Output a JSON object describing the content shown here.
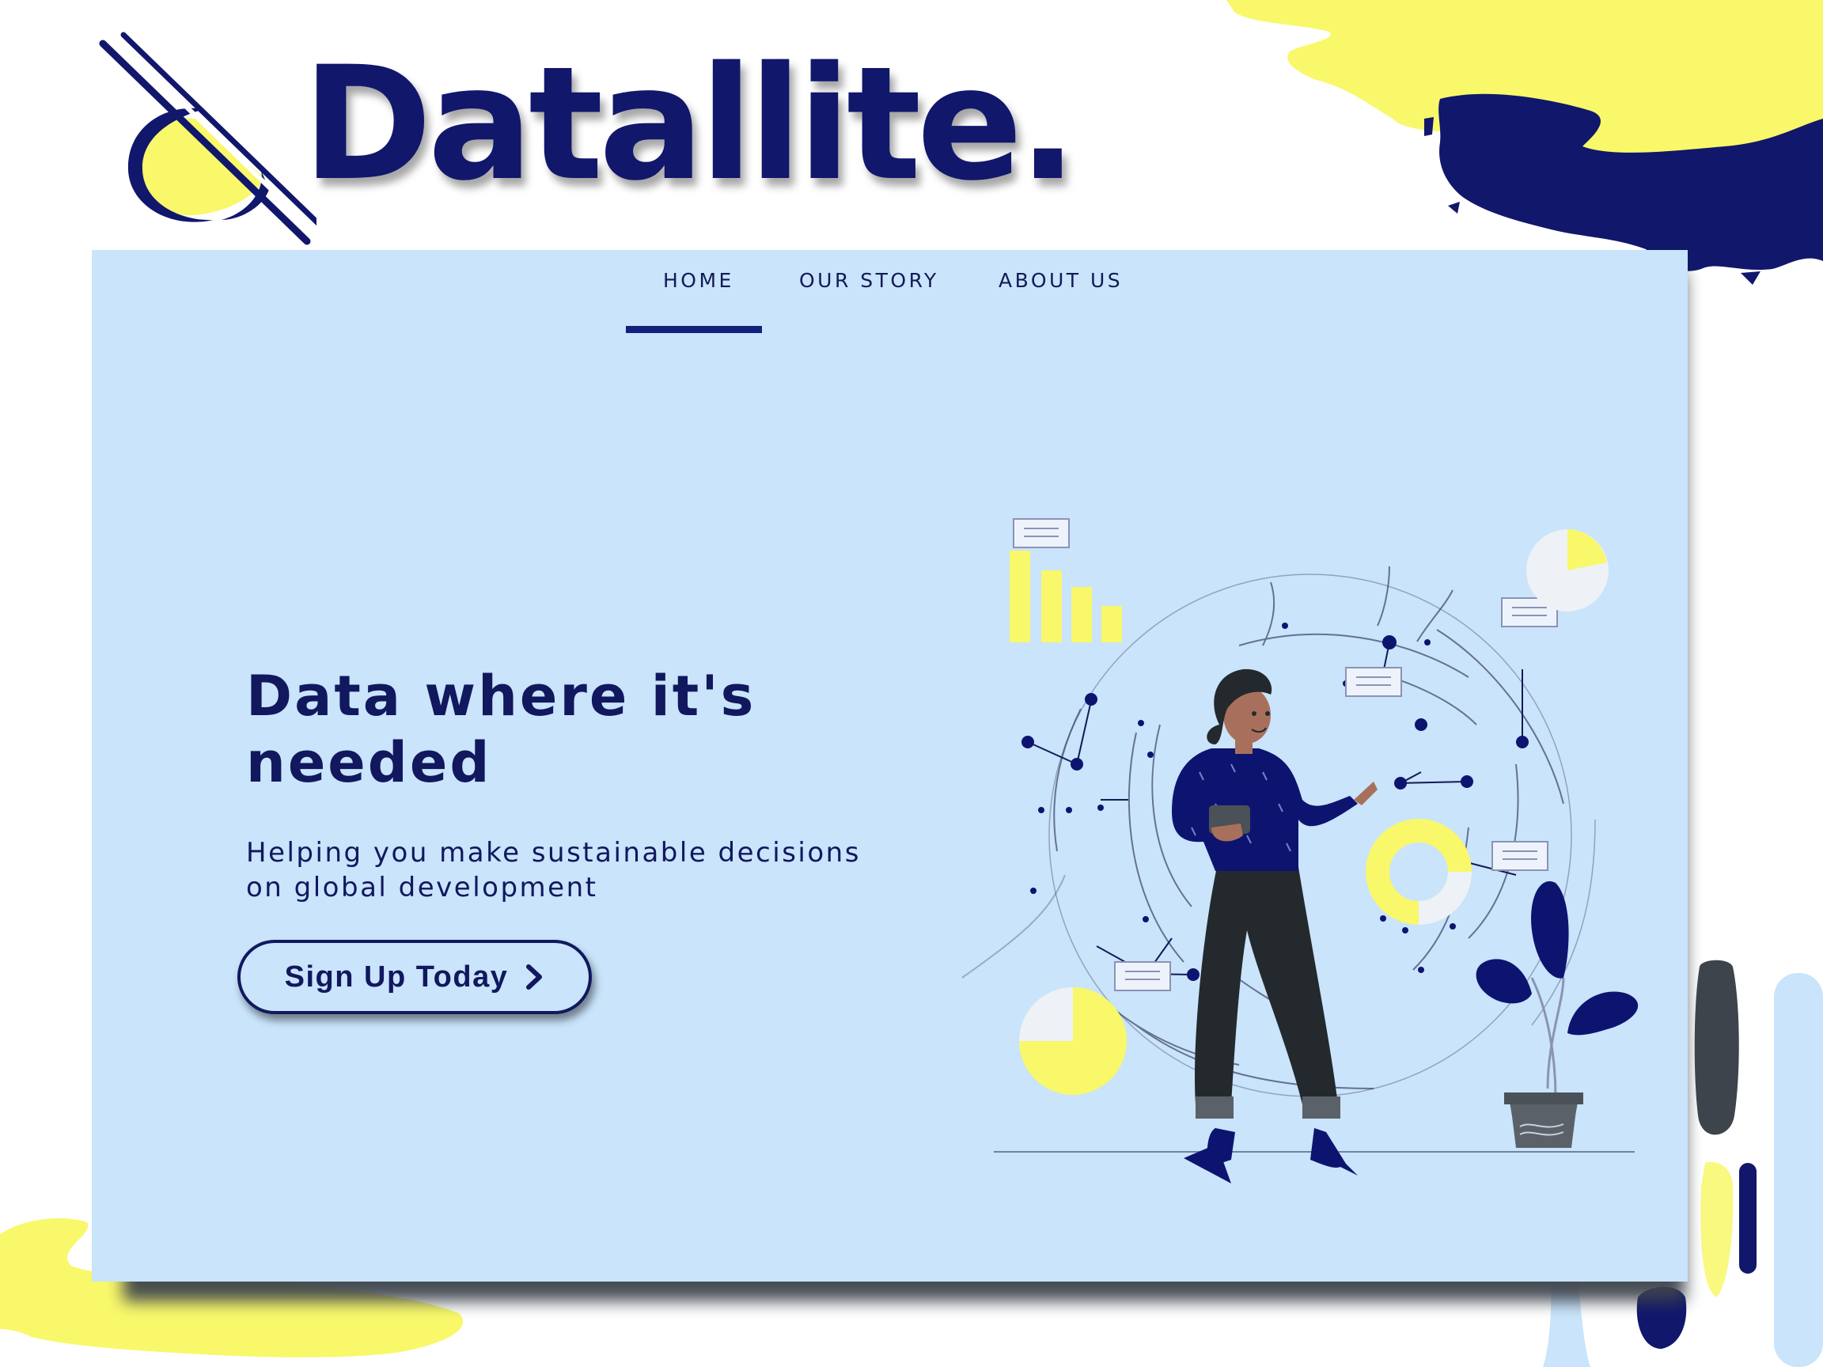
{
  "brand": {
    "name": "Datallite."
  },
  "nav": {
    "items": [
      {
        "label": "HOME",
        "active": true
      },
      {
        "label": "OUR STORY",
        "active": false
      },
      {
        "label": "ABOUT US",
        "active": false
      }
    ]
  },
  "hero": {
    "title": "Data where it's needed",
    "subtitle_line1": "Helping you make sustainable decisions",
    "subtitle_line2": "on global development",
    "cta_label": "Sign Up Today",
    "cta_icon": "chevron-right-icon"
  },
  "colors": {
    "navy": "#11185e",
    "brand_navy": "#11176b",
    "accent_yellow": "#f8f86a",
    "card_blue": "#c9e4fb",
    "shadow_gray": "#3e444c"
  }
}
